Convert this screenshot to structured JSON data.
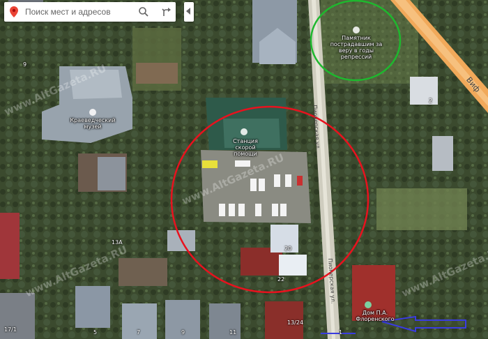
{
  "search": {
    "placeholder": "Поиск мест и адресов"
  },
  "icons": {
    "pin": "map-pin-icon",
    "search": "search-icon",
    "directions": "directions-icon",
    "collapse": "collapse-panel-icon"
  },
  "colors": {
    "pin": "#ea4335",
    "circle_red": "#e8121e",
    "circle_green": "#1eb82e",
    "arrow_blue": "#3a3ce0",
    "road_orange": "#f1a95a"
  },
  "poi": {
    "museum": "Краеведческий музей",
    "ambulance": "Станция скорой помощи",
    "monument": "Памятник пострадавшим за веру в годы репрессий",
    "house": "Дом П.А. Флоренского"
  },
  "streets": {
    "main": "Пионерская ул.",
    "main_lower": "Пионерская ул.",
    "upper_right": "Виф"
  },
  "house_numbers": [
    "9",
    "2",
    "13А",
    "20",
    "22",
    "17/1",
    "5",
    "7",
    "9",
    "11",
    "13/24",
    "1"
  ],
  "watermark": "www.AltGazeta.RU"
}
